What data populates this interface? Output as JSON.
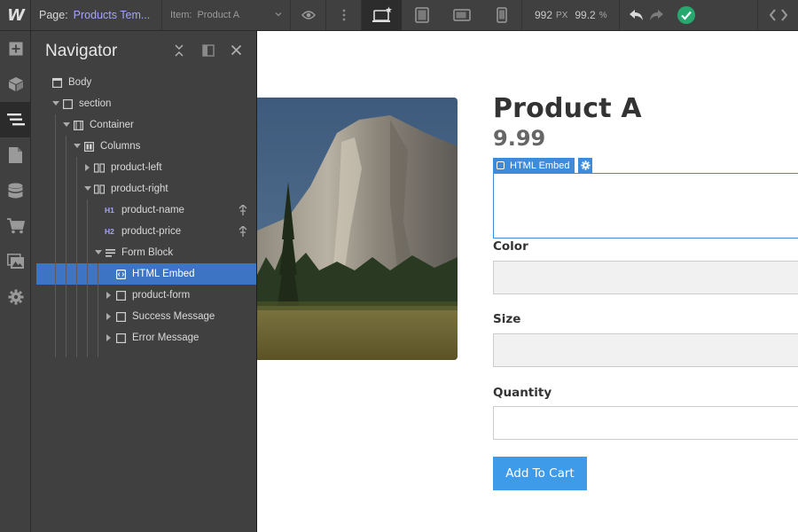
{
  "topbar": {
    "logo": "W",
    "page_label": "Page:",
    "page_value": "Products Tem...",
    "item_label": "Item:",
    "item_value": "Product A",
    "width_value": "992",
    "width_unit": "PX",
    "zoom_value": "99.2",
    "zoom_unit": "%",
    "icons": [
      "preview-eye-icon",
      "more-vertical-icon",
      "desktop-device-icon",
      "tablet-device-icon",
      "mobile-landscape-icon",
      "mobile-portrait-icon",
      "undo-icon",
      "redo-icon",
      "publish-status-check-icon",
      "code-export-icon"
    ]
  },
  "rail": {
    "items": [
      "add-panel-icon",
      "symbols-icon",
      "navigator-icon",
      "pages-icon",
      "cms-icon",
      "ecommerce-icon",
      "assets-icon",
      "settings-icon"
    ]
  },
  "navigator": {
    "title": "Navigator",
    "tree": [
      {
        "label": "Body",
        "depth": 0,
        "arrow": "",
        "icon": "body"
      },
      {
        "label": "section",
        "depth": 1,
        "arrow": "down",
        "icon": "box"
      },
      {
        "label": "Container",
        "depth": 2,
        "arrow": "down",
        "icon": "container"
      },
      {
        "label": "Columns",
        "depth": 3,
        "arrow": "down",
        "icon": "columns"
      },
      {
        "label": "product-left",
        "depth": 4,
        "arrow": "right",
        "icon": "column"
      },
      {
        "label": "product-right",
        "depth": 4,
        "arrow": "down",
        "icon": "column"
      },
      {
        "label": "product-name",
        "depth": 5,
        "arrow": "",
        "icon": "H1",
        "pinned": true
      },
      {
        "label": "product-price",
        "depth": 5,
        "arrow": "",
        "icon": "H2",
        "pinned": true
      },
      {
        "label": "Form Block",
        "depth": 5,
        "arrow": "down",
        "icon": "form"
      },
      {
        "label": "HTML Embed",
        "depth": 6,
        "arrow": "",
        "icon": "embed",
        "selected": true
      },
      {
        "label": "product-form",
        "depth": 6,
        "arrow": "right",
        "icon": "box"
      },
      {
        "label": "Success Message",
        "depth": 6,
        "arrow": "right",
        "icon": "box"
      },
      {
        "label": "Error Message",
        "depth": 6,
        "arrow": "right",
        "icon": "box"
      }
    ]
  },
  "canvas": {
    "product_name": "Product A",
    "product_price": "9.99",
    "embed_badge": "HTML Embed",
    "color_label": "Color",
    "size_label": "Size",
    "quantity_label": "Quantity",
    "cart_button": "Add To Cart"
  },
  "colors": {
    "accent": "#3d74c4",
    "selection": "#3d8bd9",
    "button": "#3d9be9",
    "publish_ok": "#27a86f",
    "page_name": "#a4a4ff"
  }
}
